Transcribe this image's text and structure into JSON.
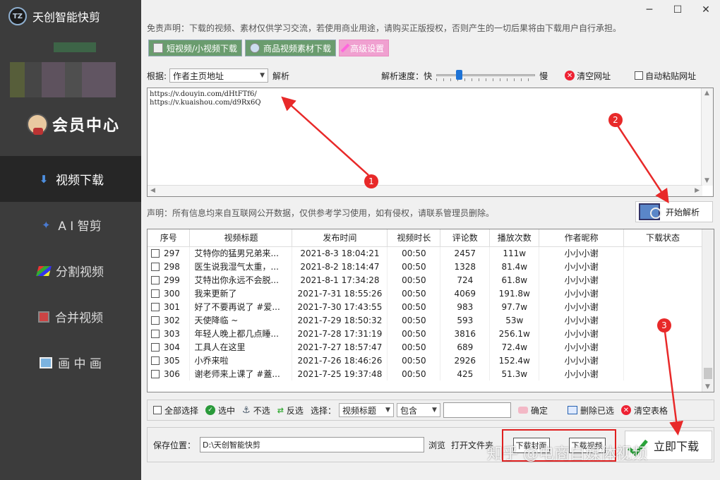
{
  "app": {
    "title": "天创智能快剪",
    "logo_text": "TZ"
  },
  "sidebar": {
    "member_center": "会员中心",
    "items": [
      {
        "label": "视频下载",
        "active": true
      },
      {
        "label": "A I 智剪"
      },
      {
        "label": "分割视频"
      },
      {
        "label": "合并视频"
      },
      {
        "label": "画 中 画"
      }
    ]
  },
  "window": {
    "min": "─",
    "max": "☐",
    "close": "✕"
  },
  "disclaimer": "免责声明：下载的视频、素材仅供学习交流，若使用商业用途，请购买正版授权，否则产生的一切后果将由下载用户自行承担。",
  "toolbar": {
    "short_video": "短视频/小视频下载",
    "goods_video": "商品视频素材下载",
    "advanced": "高级设置"
  },
  "basis": {
    "label": "根据:",
    "select_value": "作者主页地址",
    "parse_label": "解析",
    "speed_label": "解析速度：快",
    "speed_slow": "慢",
    "clear_url": "清空网址",
    "auto_paste": "自动粘贴网址"
  },
  "urls": "https://v.douyin.com/dHtFTf6/\nhttps://v.kuaishou.com/d9Rx6Q",
  "notice": "声明：所有信息均来自互联网公开数据，仅供参考学习使用，如有侵权，请联系管理员删除。",
  "parse_button": "开始解析",
  "table": {
    "columns": [
      "序号",
      "视频标题",
      "发布时间",
      "视频时长",
      "评论数",
      "播放次数",
      "作者昵称",
      "下载状态"
    ],
    "rows": [
      [
        "297",
        "艾特你的猛男兄弟来...",
        "2021-8-3 18:04:21",
        "00:50",
        "2457",
        "111w",
        "小小小谢",
        ""
      ],
      [
        "298",
        "医生说我湿气太重，...",
        "2021-8-2 18:14:47",
        "00:50",
        "1328",
        "81.4w",
        "小小小谢",
        ""
      ],
      [
        "299",
        "艾特出你永远不会脱...",
        "2021-8-1 17:34:28",
        "00:50",
        "724",
        "61.8w",
        "小小小谢",
        ""
      ],
      [
        "300",
        "我来更新了",
        "2021-7-31 18:55:26",
        "00:50",
        "4069",
        "191.8w",
        "小小小谢",
        ""
      ],
      [
        "301",
        "好了不要再说了 #爱...",
        "2021-7-30 17:43:55",
        "00:50",
        "983",
        "97.7w",
        "小小小谢",
        ""
      ],
      [
        "302",
        "天使降临 ~",
        "2021-7-29 18:50:32",
        "00:50",
        "593",
        "53w",
        "小小小谢",
        ""
      ],
      [
        "303",
        "年轻人晚上都几点睡...",
        "2021-7-28 17:31:19",
        "00:50",
        "3816",
        "256.1w",
        "小小小谢",
        ""
      ],
      [
        "304",
        "工具人在这里",
        "2021-7-27 18:57:47",
        "00:50",
        "689",
        "72.4w",
        "小小小谢",
        ""
      ],
      [
        "305",
        "小乔来啦",
        "2021-7-26 18:46:26",
        "00:50",
        "2926",
        "152.4w",
        "小小小谢",
        ""
      ],
      [
        "306",
        "谢老师来上课了 #蓋...",
        "2021-7-25 19:37:48",
        "00:50",
        "425",
        "51.3w",
        "小小小谢",
        ""
      ]
    ]
  },
  "select_bar": {
    "select_all": "全部选择",
    "select": "选中",
    "unselect": "不选",
    "invert": "反选",
    "choose_label": "选择：",
    "field_value": "视频标题",
    "match_value": "包含",
    "confirm": "确定",
    "delete_selected": "删除已选",
    "clear_table": "清空表格"
  },
  "save_bar": {
    "label": "保存位置：",
    "path": "D:\\天创智能快剪",
    "browse": "浏览",
    "open_folder": "打开文件夹",
    "dl_cover": "下载封面",
    "dl_video": "下载视频",
    "download_now": "立即下载"
  },
  "annotations": [
    "1",
    "2",
    "3"
  ],
  "watermark": "知乎 @电商自媒体视频",
  "colors": {
    "sidebar": "#3c3c3c",
    "accent_red": "#e82929",
    "toolbar_green": "#6a9c6e",
    "toolbar_pink": "#f0a0d0"
  }
}
